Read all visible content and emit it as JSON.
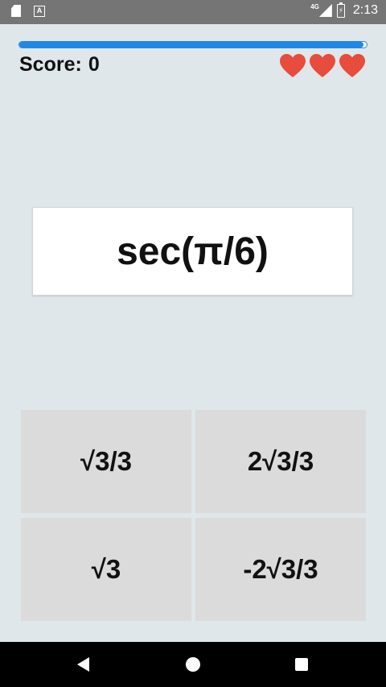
{
  "status_bar": {
    "network": "4G",
    "time": "2:13",
    "icons": [
      "sd-card-icon",
      "text-a-icon",
      "signal-icon",
      "battery-icon"
    ]
  },
  "game": {
    "progress_fraction": 0.99,
    "score_label": "Score:",
    "score_value": "0",
    "lives": 3,
    "heart_color": "#e74c3c",
    "accent_color": "#1e88e5"
  },
  "question": {
    "text": "sec(π/6)"
  },
  "answers": [
    {
      "label": "√3/3"
    },
    {
      "label": "2√3/3"
    },
    {
      "label": "√3"
    },
    {
      "label": "-2√3/3"
    }
  ],
  "nav": {
    "icons": [
      "back-icon",
      "home-icon",
      "recents-icon"
    ]
  }
}
